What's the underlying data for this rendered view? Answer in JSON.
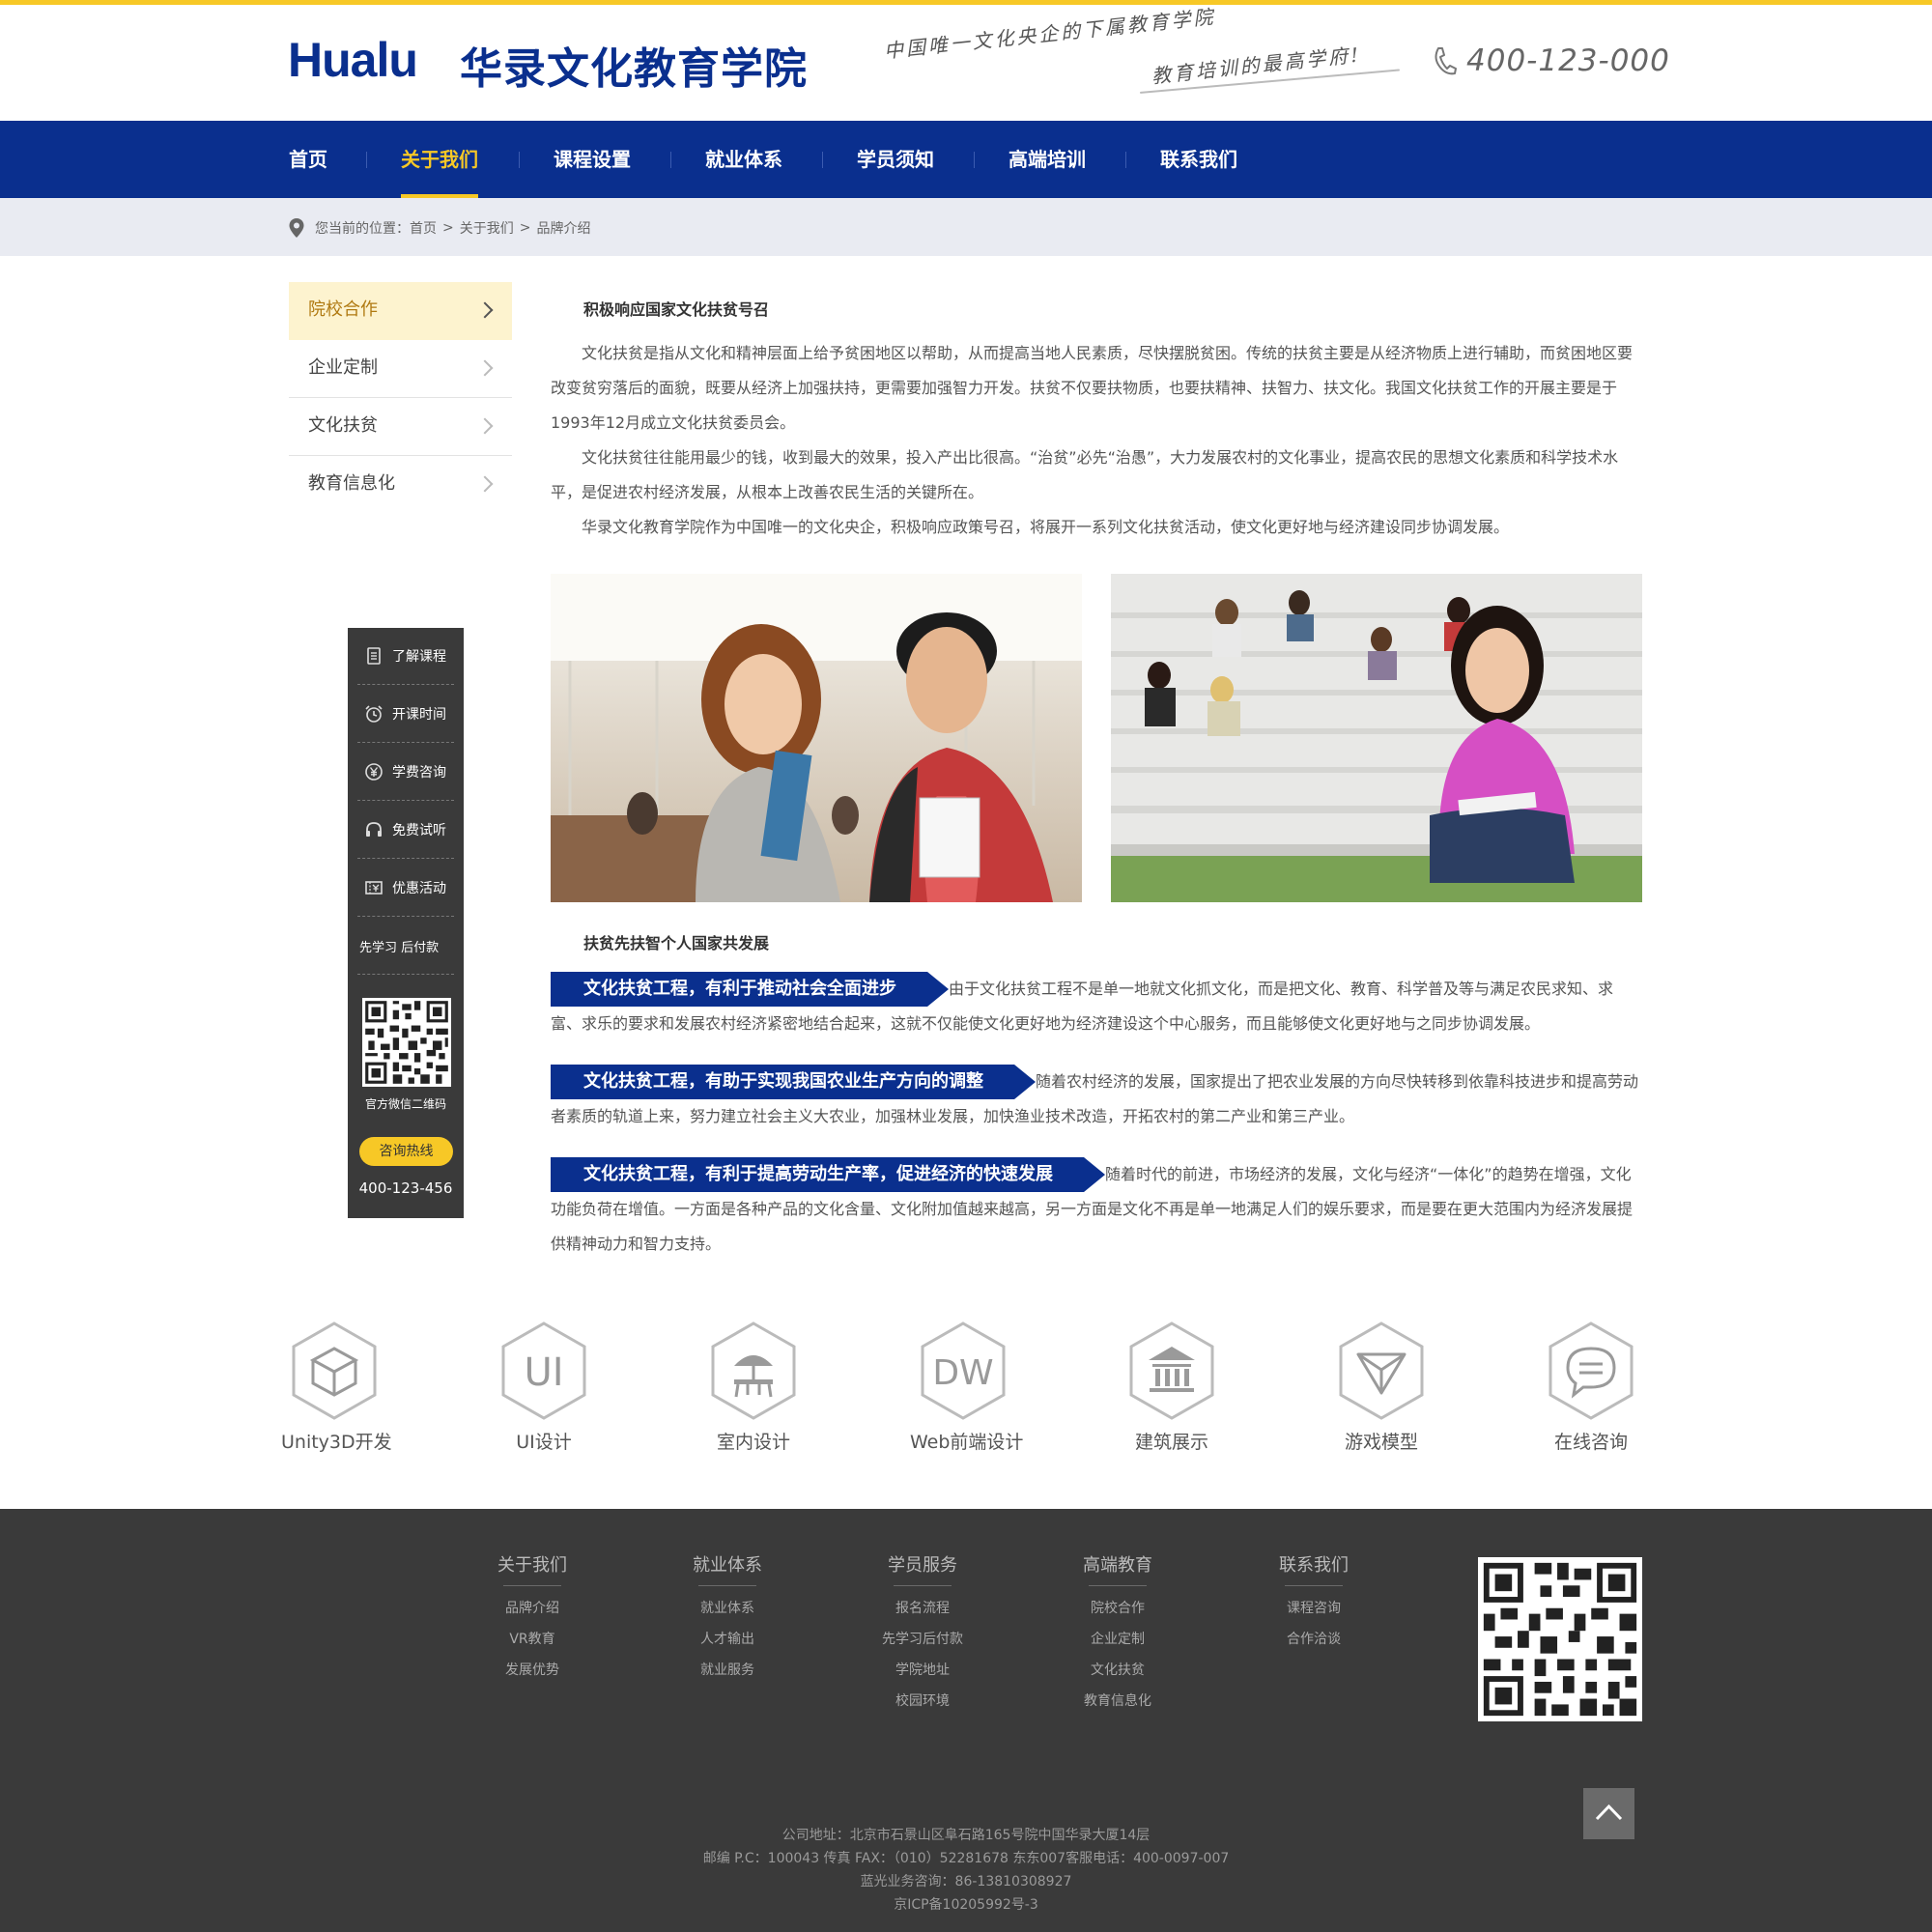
{
  "header": {
    "logo_en": "Hualu",
    "logo_cn": "华录文化教育学院",
    "slogan_line1": "中国唯一文化央企的下属教育学院",
    "slogan_line2": "教育培训的最高学府!",
    "hotline": "400-123-000"
  },
  "nav": {
    "items": [
      "首页",
      "关于我们",
      "课程设置",
      "就业体系",
      "学员须知",
      "高端培训",
      "联系我们"
    ],
    "active_index": 1
  },
  "breadcrumb": {
    "prefix": "您当前的位置：",
    "items": [
      "首页",
      ">",
      "关于我们",
      ">",
      "品牌介绍"
    ]
  },
  "sidebar": {
    "items": [
      "院校合作",
      "企业定制",
      "文化扶贫",
      "教育信息化"
    ],
    "active_index": 0
  },
  "float_panel": {
    "items": [
      "了解课程",
      "开课时间",
      "学费咨询",
      "免费试听",
      "优惠活动",
      "先学习 后付款"
    ],
    "qr_label": "官方微信二维码",
    "button": "咨询热线",
    "phone": "400-123-456"
  },
  "content": {
    "section1_title": "积极响应国家文化扶贫号召",
    "para1": "　　文化扶贫是指从文化和精神层面上给予贫困地区以帮助，从而提高当地人民素质，尽快摆脱贫困。传统的扶贫主要是从经济物质上进行辅助，而贫困地区要改变贫穷落后的面貌，既要从经济上加强扶持，更需要加强智力开发。扶贫不仅要扶物质，也要扶精神、扶智力、扶文化。我国文化扶贫工作的开展主要是于1993年12月成立文化扶贫委员会。",
    "para2": "　　文化扶贫往往能用最少的钱，收到最大的效果，投入产出比很高。“治贫”必先“治愚”，大力发展农村的文化事业，提高农民的思想文化素质和科学技术水平，是促进农村经济发展，从根本上改善农民生活的关键所在。",
    "para3": "　　华录文化教育学院作为中国唯一的文化央企，积极响应政策号召，将展开一系列文化扶贫活动，使文化更好地与经济建设同步协调发展。",
    "section2_title": "扶贫先扶智个人国家共发展",
    "banners": [
      {
        "title": "文化扶贫工程，有利于推动社会全面进步",
        "text": "由于文化扶贫工程不是单一地就文化抓文化，而是把文化、教育、科学普及等与满足农民求知、求富、求乐的要求和发展农村经济紧密地结合起来，这就不仅能使文化更好地为经济建设这个中心服务，而且能够使文化更好地与之同步协调发展。"
      },
      {
        "title": "文化扶贫工程，有助于实现我国农业生产方向的调整",
        "text": "随着农村经济的发展，国家提出了把农业发展的方向尽快转移到依靠科技进步和提高劳动者素质的轨道上来，努力建立社会主义大农业，加强林业发展，加快渔业技术改造，开拓农村的第二产业和第三产业。"
      },
      {
        "title": "文化扶贫工程，有利于提高劳动生产率，促进经济的快速发展",
        "text": "随着时代的前进，市场经济的发展，文化与经济“一体化”的趋势在增强，文化功能负荷在增值。一方面是各种产品的文化含量、文化附加值越来越高，另一方面是文化不再是单一地满足人们的娱乐要求，而是要在更大范围内为经济发展提供精神动力和智力支持。"
      }
    ]
  },
  "categories": [
    {
      "label": "Unity3D开发",
      "icon": "cube-icon"
    },
    {
      "label": "UI设计",
      "icon": "ui-icon",
      "glyph": "UI"
    },
    {
      "label": "室内设计",
      "icon": "interior-icon"
    },
    {
      "label": "Web前端设计",
      "icon": "dw-icon",
      "glyph": "DW"
    },
    {
      "label": "建筑展示",
      "icon": "building-icon"
    },
    {
      "label": "游戏模型",
      "icon": "game-icon"
    },
    {
      "label": "在线咨询",
      "icon": "chat-icon"
    }
  ],
  "footer": {
    "columns": [
      {
        "title": "关于我们",
        "links": [
          "品牌介绍",
          "VR教育",
          "发展优势"
        ]
      },
      {
        "title": "就业体系",
        "links": [
          "就业体系",
          "人才输出",
          "就业服务"
        ]
      },
      {
        "title": "学员服务",
        "links": [
          "报名流程",
          "先学习后付款",
          "学院地址",
          "校园环境"
        ]
      },
      {
        "title": "高端教育",
        "links": [
          "院校合作",
          "企业定制",
          "文化扶贫",
          "教育信息化"
        ]
      },
      {
        "title": "联系我们",
        "links": [
          "课程咨询",
          "合作洽谈"
        ]
      }
    ],
    "info": [
      "公司地址：北京市石景山区阜石路165号院中国华录大厦14层",
      "邮编 P.C：100043 传真 FAX：（010）52281678 东东007客服电话：400-0097-007",
      "蓝光业务咨询：86-13810308927",
      "京ICP备10205992号-3"
    ]
  },
  "colors": {
    "brand_blue": "#0a2f8e",
    "accent_yellow": "#f7c826",
    "footer_bg": "#3a3a3a"
  }
}
